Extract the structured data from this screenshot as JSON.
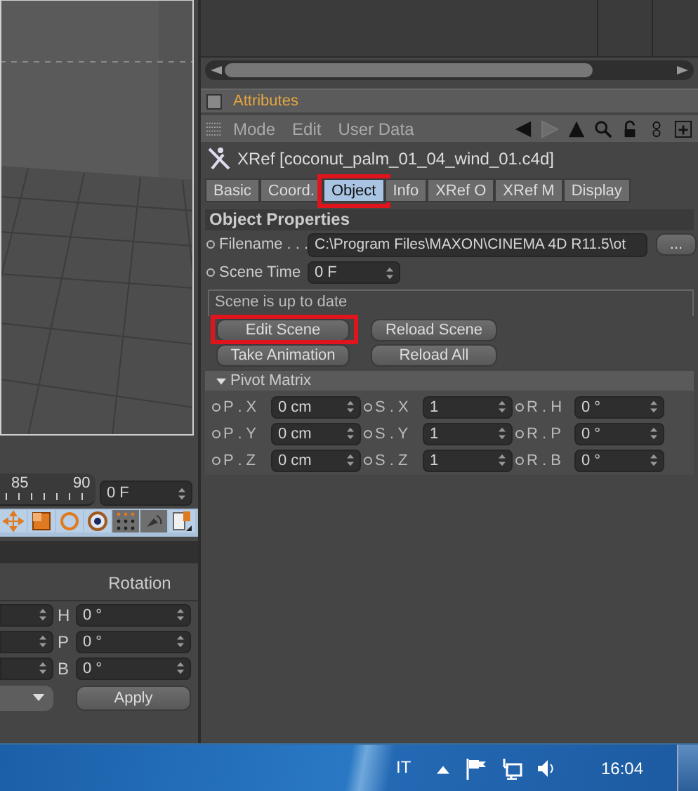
{
  "timeline": {
    "ticks": [
      "85",
      "90"
    ],
    "frame_field": "0 F"
  },
  "coordinates": {
    "header": "Rotation",
    "rows": [
      {
        "axis": "H",
        "value": "0 °"
      },
      {
        "axis": "P",
        "value": "0 °"
      },
      {
        "axis": "B",
        "value": "0 °"
      }
    ],
    "apply_button": "Apply"
  },
  "attributes": {
    "title": "Attributes",
    "checked": false,
    "menu": [
      "Mode",
      "Edit",
      "User Data"
    ],
    "object_title": "XRef [coconut_palm_01_04_wind_01.c4d]",
    "tabs": [
      {
        "label": "Basic",
        "selected": false,
        "highlighted": false
      },
      {
        "label": "Coord.",
        "selected": false,
        "highlighted": false
      },
      {
        "label": "Object",
        "selected": true,
        "highlighted": true
      },
      {
        "label": "Info",
        "selected": false,
        "highlighted": false
      },
      {
        "label": "XRef O",
        "selected": false,
        "highlighted": false
      },
      {
        "label": "XRef M",
        "selected": false,
        "highlighted": false
      },
      {
        "label": "Display",
        "selected": false,
        "highlighted": false
      }
    ],
    "section": "Object Properties",
    "fields": [
      {
        "kind": "file",
        "label": "Filename . . .",
        "value": "C:\\Program Files\\MAXON\\CINEMA 4D R11.5\\ot",
        "browse_button": "..."
      },
      {
        "kind": "spinner",
        "label": "Scene Time",
        "value": "0 F"
      }
    ],
    "status": "Scene is up to date",
    "buttons": [
      {
        "label": "Edit Scene",
        "highlighted": true
      },
      {
        "label": "Reload Scene",
        "highlighted": false
      },
      {
        "label": "Take Animation",
        "highlighted": false
      },
      {
        "label": "Reload All",
        "highlighted": false
      }
    ],
    "pivot": {
      "title": "Pivot Matrix",
      "expanded": true,
      "fields": [
        {
          "label": "P . X",
          "value": "0 cm"
        },
        {
          "label": "S . X",
          "value": "1"
        },
        {
          "label": "R . H",
          "value": "0 °"
        },
        {
          "label": "P . Y",
          "value": "0 cm"
        },
        {
          "label": "S . Y",
          "value": "1"
        },
        {
          "label": "R . P",
          "value": "0 °"
        },
        {
          "label": "P . Z",
          "value": "0 cm"
        },
        {
          "label": "S . Z",
          "value": "1"
        },
        {
          "label": "R . B",
          "value": "0 °"
        }
      ]
    }
  },
  "taskbar": {
    "language": "IT",
    "clock": "16:04"
  }
}
